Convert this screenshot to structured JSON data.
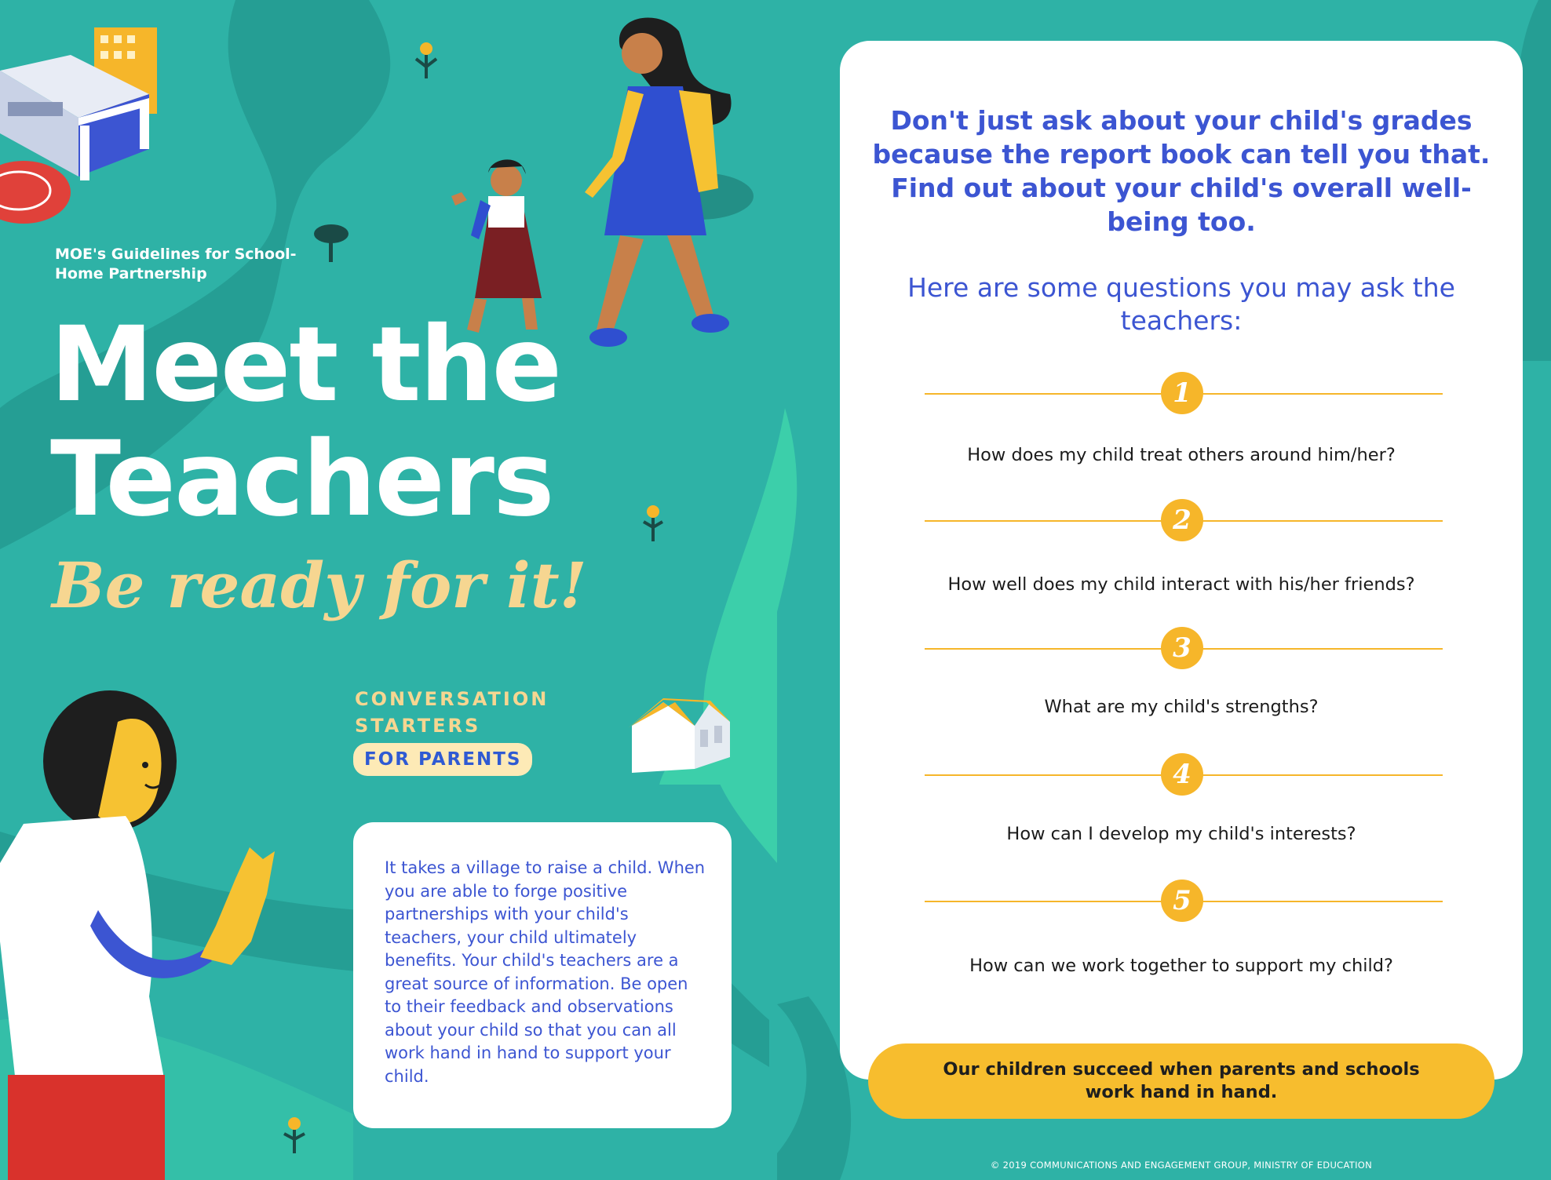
{
  "left_panel": {
    "guideline": "MOE's Guidelines for School-Home Partnership",
    "title_line1": "Meet the",
    "title_line2": "Teachers",
    "tagline": "Be ready for it!",
    "conversation_line1": "CONVERSATION",
    "conversation_line2": "STARTERS",
    "for_parents": "FOR PARENTS",
    "intro": "It takes a village to raise a child. When you are able to forge positive partnerships with your child's teachers, your child ultimately benefits. Your child's teachers are a great source of information. Be open to their feedback and observations about your child so that you can all work hand in hand to support your child."
  },
  "right_panel": {
    "headline": "Don't just ask about your child's grades because the report book can tell you that. Find out about your child's overall well-being too.",
    "subhead": "Here are some questions you may ask the teachers:",
    "questions": [
      {
        "number": "1",
        "text": "How does my child treat others around him/her?"
      },
      {
        "number": "2",
        "text": "How well does my child interact with his/her friends?"
      },
      {
        "number": "3",
        "text": "What are my child's strengths?"
      },
      {
        "number": "4",
        "text": "How can I develop my child's interests?"
      },
      {
        "number": "5",
        "text": "How can we work together to support my child?"
      }
    ],
    "banner": "Our children succeed when parents and schools work hand in hand.",
    "footer": "© 2019 COMMUNICATIONS AND ENGAGEMENT GROUP, MINISTRY OF EDUCATION"
  },
  "colors": {
    "background": "#2eb2a6",
    "accent_blue": "#3c55d2",
    "accent_yellow": "#f6b62a",
    "cream": "#f6d691"
  },
  "icons": [
    "school-building-illustration",
    "mother-and-daughter-illustration",
    "boy-waving-illustration",
    "house-illustration",
    "tree-icon",
    "flower-icon"
  ]
}
